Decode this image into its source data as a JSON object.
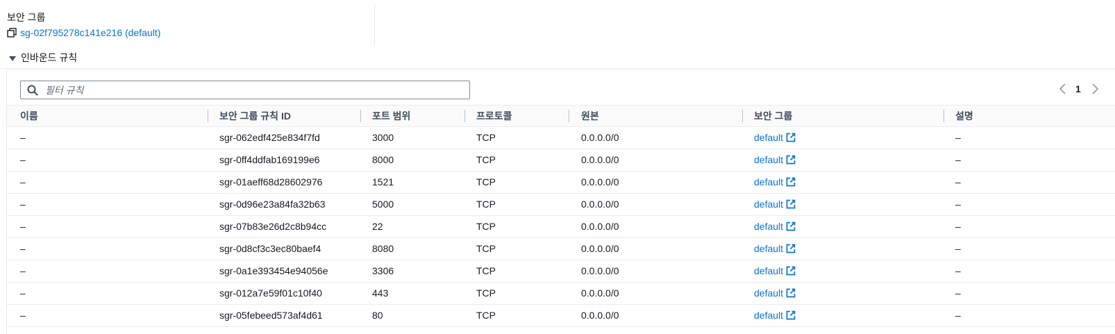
{
  "security_group": {
    "label": "보안 그룹",
    "value": "sg-02f795278c141e216 (default)"
  },
  "inbound_rules": {
    "title": "인바운드 규칙",
    "filter": {
      "placeholder": "필터 규칙",
      "value": ""
    },
    "pagination": {
      "current_page": "1"
    },
    "columns": [
      "이름",
      "보안 그룹 규칙 ID",
      "포트 범위",
      "프로토콜",
      "원본",
      "보안 그룹",
      "설명"
    ],
    "rows": [
      {
        "name": "–",
        "rule_id": "sgr-062edf425e834f7fd",
        "port": "3000",
        "protocol": "TCP",
        "source": "0.0.0.0/0",
        "security_group": "default",
        "description": "–"
      },
      {
        "name": "–",
        "rule_id": "sgr-0ff4ddfab169199e6",
        "port": "8000",
        "protocol": "TCP",
        "source": "0.0.0.0/0",
        "security_group": "default",
        "description": "–"
      },
      {
        "name": "–",
        "rule_id": "sgr-01aeff68d28602976",
        "port": "1521",
        "protocol": "TCP",
        "source": "0.0.0.0/0",
        "security_group": "default",
        "description": "–"
      },
      {
        "name": "–",
        "rule_id": "sgr-0d96e23a84fa32b63",
        "port": "5000",
        "protocol": "TCP",
        "source": "0.0.0.0/0",
        "security_group": "default",
        "description": "–"
      },
      {
        "name": "–",
        "rule_id": "sgr-07b83e26d2c8b94cc",
        "port": "22",
        "protocol": "TCP",
        "source": "0.0.0.0/0",
        "security_group": "default",
        "description": "–"
      },
      {
        "name": "–",
        "rule_id": "sgr-0d8cf3c3ec80baef4",
        "port": "8080",
        "protocol": "TCP",
        "source": "0.0.0.0/0",
        "security_group": "default",
        "description": "–"
      },
      {
        "name": "–",
        "rule_id": "sgr-0a1e393454e94056e",
        "port": "3306",
        "protocol": "TCP",
        "source": "0.0.0.0/0",
        "security_group": "default",
        "description": "–"
      },
      {
        "name": "–",
        "rule_id": "sgr-012a7e59f01c10f40",
        "port": "443",
        "protocol": "TCP",
        "source": "0.0.0.0/0",
        "security_group": "default",
        "description": "–"
      },
      {
        "name": "–",
        "rule_id": "sgr-05febeed573af4d61",
        "port": "80",
        "protocol": "TCP",
        "source": "0.0.0.0/0",
        "security_group": "default",
        "description": "–"
      }
    ]
  },
  "icons": {
    "copy": "copy-icon",
    "caret": "caret-down-icon",
    "search": "search-icon",
    "prev": "chevron-left-icon",
    "next": "chevron-right-icon",
    "external": "external-link-icon"
  },
  "colors": {
    "link": "#0972d3",
    "text": "#16191f",
    "header_text": "#414d5c",
    "border": "#e9ebed"
  }
}
